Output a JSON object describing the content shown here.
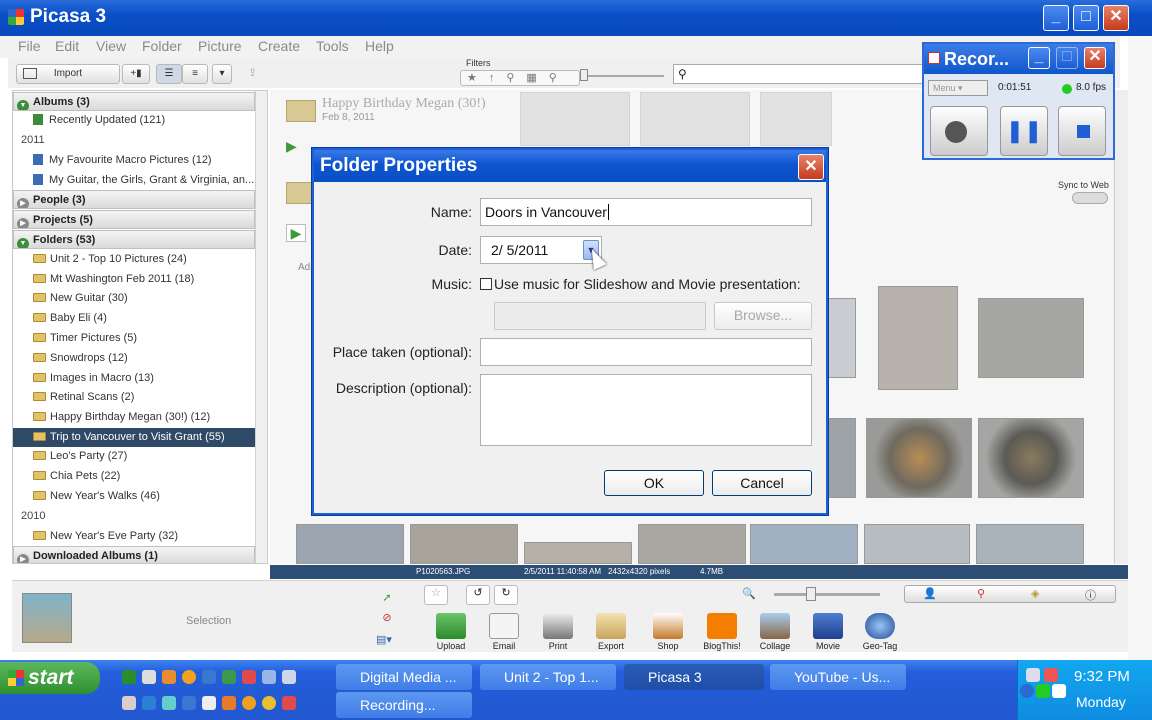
{
  "window": {
    "title": "Picasa 3"
  },
  "menu": [
    "File",
    "Edit",
    "View",
    "Folder",
    "Picture",
    "Create",
    "Tools",
    "Help"
  ],
  "toolbar": {
    "import": "Import",
    "filters": "Filters"
  },
  "sidebar": {
    "albums_header": "Albums (3)",
    "recently_updated": "Recently Updated (121)",
    "year_2011": "2011",
    "album1": "My Favourite Macro Pictures (12)",
    "album2": "My Guitar, the Girls, Grant & Virginia, an...",
    "people_header": "People (3)",
    "projects_header": "Projects (5)",
    "folders_header": "Folders (53)",
    "folders": [
      "Unit 2 - Top 10 Pictures (24)",
      "Mt Washington Feb 2011 (18)",
      "New Guitar (30)",
      "Baby Eli (4)",
      "Timer Pictures (5)",
      "Snowdrops (12)",
      "Images in Macro (13)",
      "Retinal Scans (2)",
      "Happy Birthday Megan (30!) (12)",
      "Trip to Vancouver to Visit Grant (55)",
      "Leo's Party (27)",
      "Chia Pets (22)",
      "New Year's Walks (46)"
    ],
    "year_2010": "2010",
    "folder_2010": "New Year's Eve Party (32)",
    "downloaded_header": "Downloaded Albums (1)"
  },
  "main": {
    "album_title": "Happy Birthday Megan (30!)",
    "album_date": "Feb 8, 2011",
    "sync_label": "Sync to Web",
    "add_label": "Ad"
  },
  "infobar": {
    "filename": "P1020563.JPG",
    "datetime": "2/5/2011 11:40:58 AM",
    "dimensions": "2432x4320 pixels",
    "size": "4.7MB"
  },
  "tray": {
    "selection_label": "Selection"
  },
  "tools": [
    "Upload",
    "Email",
    "Print",
    "Export",
    "Shop",
    "BlogThis!",
    "Collage",
    "Movie",
    "Geo-Tag"
  ],
  "dialog": {
    "title": "Folder Properties",
    "name_label": "Name:",
    "name_value": "Doors in Vancouver",
    "date_label": "Date:",
    "date_value": "2/  5/2011",
    "music_label": "Music:",
    "music_checkbox": "Use music for Slideshow and Movie presentation:",
    "browse": "Browse...",
    "place_label": "Place taken (optional):",
    "description_label": "Description (optional):",
    "ok": "OK",
    "cancel": "Cancel"
  },
  "recorder": {
    "title": "Recor...",
    "menu": "Menu",
    "time": "0:01:51",
    "fps": "8.0 fps"
  },
  "taskbar": {
    "start": "start",
    "tasks": [
      "Digital Media ...",
      "Unit 2 - Top 1...",
      "Picasa 3",
      "YouTube - Us...",
      "Recording..."
    ],
    "clock": "9:32 PM",
    "day": "Monday"
  },
  "colors": {
    "xp_blue": "#0a4fc7",
    "selection": "#2f4a66",
    "start_green": "#2f8f2f"
  }
}
